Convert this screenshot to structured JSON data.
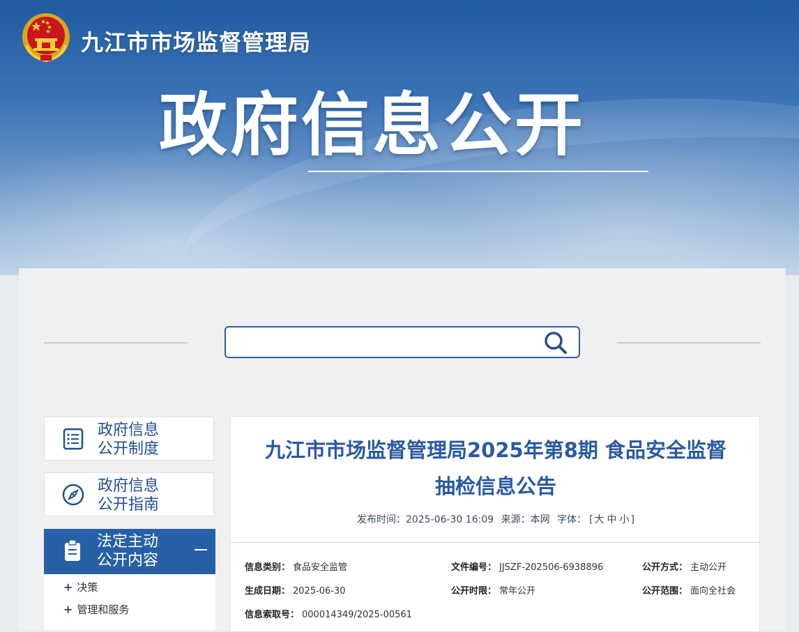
{
  "header": {
    "site_name": "九江市市场监督管理局",
    "page_title": "政府信息公开"
  },
  "search": {
    "placeholder": ""
  },
  "sidebar": {
    "items": [
      {
        "line1": "政府信息",
        "line2": "公开制度",
        "icon": "document-list-icon"
      },
      {
        "line1": "政府信息",
        "line2": "公开指南",
        "icon": "compass-icon"
      },
      {
        "line1": "法定主动",
        "line2": "公开内容",
        "icon": "clipboard-icon",
        "active": true
      }
    ],
    "sub_items": [
      {
        "label": "决策"
      },
      {
        "label": "管理和服务"
      }
    ]
  },
  "article": {
    "title_line1": "九江市市场监督管理局2025年第8期 食品安全监督",
    "title_line2": "抽检信息公告",
    "publish_label": "发布时间：",
    "publish_time": "2025-06-30 16:09",
    "source_label": "来源：",
    "source": "本网",
    "font_label": "字体：",
    "font_open": "[",
    "font_large": "大",
    "font_medium": "中",
    "font_small": "小",
    "font_close": "]"
  },
  "info": {
    "category_label": "信息类别：",
    "category": "食品安全监管",
    "doc_no_label": "文件编号：",
    "doc_no": "JJSZF-202506-6938896",
    "open_mode_label": "公开方式：",
    "open_mode": "主动公开",
    "date_label": "生成日期：",
    "date": "2025-06-30",
    "period_label": "公开时限：",
    "period": "常年公开",
    "scope_label": "公开范围：",
    "scope": "面向全社会",
    "index_label": "信息索取号：",
    "index_no": "000014349/2025-00561"
  },
  "colors": {
    "accent": "#2860a5",
    "title": "#2a5aa0"
  }
}
